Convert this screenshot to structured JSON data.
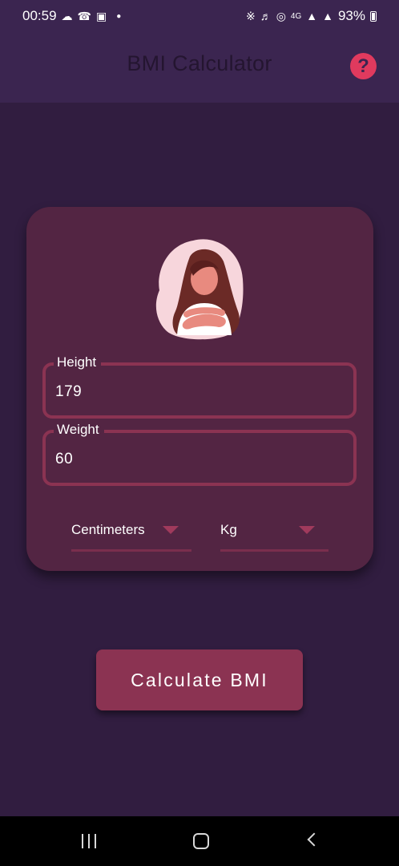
{
  "status_bar": {
    "time": "00:59",
    "battery": "93%",
    "network": "4G",
    "left_icons": [
      "snapchat-icon",
      "whatsapp-icon",
      "gallery-icon",
      "dot-icon"
    ],
    "right_icons": [
      "bluetooth-icon",
      "mute-icon",
      "hotspot-icon",
      "4g-icon",
      "signal-icon",
      "signal-icon",
      "battery-icon"
    ]
  },
  "app_bar": {
    "title": "BMI Calculator",
    "help_icon": "help-icon",
    "help_glyph": "?"
  },
  "form": {
    "height_label": "Height",
    "height_value": "179",
    "weight_label": "Weight",
    "weight_value": "60",
    "height_unit": "Centimeters",
    "weight_unit": "Kg"
  },
  "actions": {
    "calculate_label": "Calculate BMI"
  },
  "colors": {
    "background": "#311d40",
    "app_bar": "#3b2550",
    "card": "#532543",
    "accent": "#8b3352",
    "help": "#e03a5e"
  }
}
